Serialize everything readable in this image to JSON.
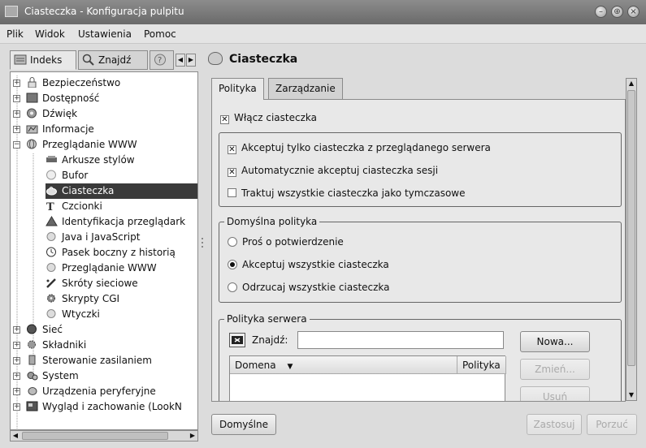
{
  "window": {
    "title": "Ciasteczka - Konfiguracja pulpitu",
    "buttons": [
      "minimize",
      "maximize",
      "close"
    ]
  },
  "menu": {
    "items": [
      "Plik",
      "Widok",
      "Ustawienia",
      "Pomoc"
    ]
  },
  "left_tabs": {
    "index": "Indeks",
    "search": "Znajdź"
  },
  "tree": {
    "items": [
      {
        "label": "Bezpieczeństwo",
        "level": 0,
        "expander": "+"
      },
      {
        "label": "Dostępność",
        "level": 0,
        "expander": "+"
      },
      {
        "label": "Dźwięk",
        "level": 0,
        "expander": "+"
      },
      {
        "label": "Informacje",
        "level": 0,
        "expander": "+"
      },
      {
        "label": "Przeglądanie WWW",
        "level": 0,
        "expander": "−"
      },
      {
        "label": "Arkusze stylów",
        "level": 1
      },
      {
        "label": "Bufor",
        "level": 1
      },
      {
        "label": "Ciasteczka",
        "level": 1,
        "selected": true
      },
      {
        "label": "Czcionki",
        "level": 1
      },
      {
        "label": "Identyfikacja przeglądark",
        "level": 1
      },
      {
        "label": "Java i JavaScript",
        "level": 1
      },
      {
        "label": "Pasek boczny z historią",
        "level": 1
      },
      {
        "label": "Przeglądanie WWW",
        "level": 1
      },
      {
        "label": "Skróty sieciowe",
        "level": 1
      },
      {
        "label": "Skrypty CGI",
        "level": 1
      },
      {
        "label": "Wtyczki",
        "level": 1
      },
      {
        "label": "Sieć",
        "level": 0,
        "expander": "+"
      },
      {
        "label": "Składniki",
        "level": 0,
        "expander": "+"
      },
      {
        "label": "Sterowanie zasilaniem",
        "level": 0,
        "expander": "+"
      },
      {
        "label": "System",
        "level": 0,
        "expander": "+"
      },
      {
        "label": "Urządzenia peryferyjne",
        "level": 0,
        "expander": "+"
      },
      {
        "label": "Wygląd i zachowanie (LookN",
        "level": 0,
        "expander": "+"
      }
    ]
  },
  "module": {
    "title": "Ciasteczka",
    "tabs": [
      "Polityka",
      "Zarządzanie"
    ],
    "enable_cookies": {
      "label": "Włącz ciasteczka",
      "checked": true
    },
    "options": [
      {
        "label": "Akceptuj tylko ciasteczka z przeglądanego serwera",
        "checked": true
      },
      {
        "label": "Automatycznie akceptuj ciasteczka sesji",
        "checked": true
      },
      {
        "label": "Traktuj wszystkie ciasteczka jako tymczasowe",
        "checked": false
      }
    ],
    "default_policy": {
      "title": "Domyślna polityka",
      "options": [
        {
          "label": "Proś o potwierdzenie",
          "selected": false
        },
        {
          "label": "Akceptuj wszystkie ciasteczka",
          "selected": true
        },
        {
          "label": "Odrzucaj wszystkie ciasteczka",
          "selected": false
        }
      ]
    },
    "server_policy": {
      "title": "Polityka serwera",
      "search_label": "Znajdź:",
      "search_value": "",
      "columns": [
        "Domena",
        "Polityka"
      ],
      "buttons": {
        "new": "Nowa...",
        "change": "Zmień...",
        "delete": "Usuń"
      }
    }
  },
  "bottom_buttons": {
    "defaults": "Domyślne",
    "apply": "Zastosuj",
    "reset": "Porzuć"
  }
}
